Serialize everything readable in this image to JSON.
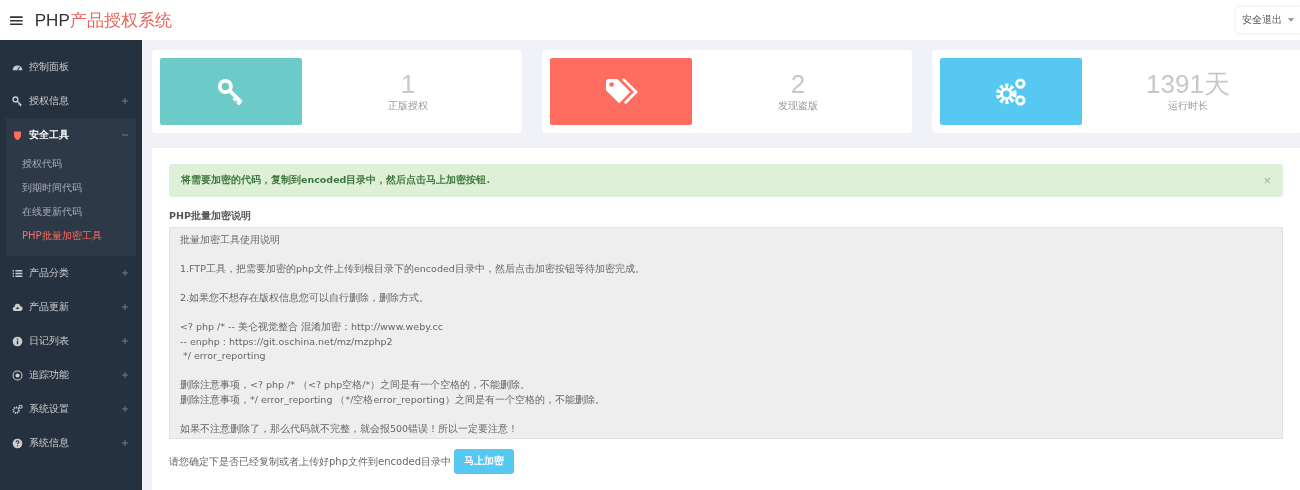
{
  "header": {
    "menu_glyph": "≡",
    "title_prefix": "PHP",
    "title_rest": "产品授权系统",
    "user_menu": "安全退出"
  },
  "sidebar": {
    "items": [
      {
        "label": "控制面板",
        "kind": "dashboard"
      },
      {
        "label": "授权信息",
        "kind": "key",
        "expanded": false
      },
      {
        "label": "安全工具",
        "kind": "shield",
        "expanded": true,
        "children": [
          {
            "label": "授权代码",
            "selected": false
          },
          {
            "label": "到期时间代码",
            "selected": false
          },
          {
            "label": "在线更新代码",
            "selected": false
          },
          {
            "label": "PHP批量加密工具",
            "selected": true
          }
        ]
      },
      {
        "label": "产品分类",
        "kind": "list",
        "expanded": false
      },
      {
        "label": "产品更新",
        "kind": "cloud",
        "expanded": false
      },
      {
        "label": "日记列表",
        "kind": "info",
        "expanded": false
      },
      {
        "label": "追踪功能",
        "kind": "target",
        "expanded": false
      },
      {
        "label": "系统设置",
        "kind": "gears",
        "expanded": false
      },
      {
        "label": "系统信息",
        "kind": "question",
        "expanded": false
      }
    ]
  },
  "stats": [
    {
      "kind": "key",
      "color": "#6ccac9",
      "value": "1",
      "label": "正版授权"
    },
    {
      "kind": "tags",
      "color": "#ff6c60",
      "value": "2",
      "label": "发现盗版"
    },
    {
      "kind": "gears",
      "color": "#57c8f2",
      "value": "1391天",
      "label": "运行时长"
    }
  ],
  "alert": {
    "text": "将需要加密的代码，复制到encoded目录中，然后点击马上加密按钮.",
    "close": "×"
  },
  "editor": {
    "label": "PHP批量加密说明",
    "paragraphs": [
      [
        "批量加密工具使用说明"
      ],
      [
        "1.FTP工具，把需要加密的php文件上传到根目录下的encoded目录中，然后点击加密按钮等待加密完成。"
      ],
      [
        "2.如果您不想存在版权信息您可以自行删除，删除方式。"
      ],
      [
        "<? php /* -- 美仑视觉整合 混淆加密：http://www.weby.cc",
        "-- enphp : https://git.oschina.net/mz/mzphp2",
        " */ error_reporting"
      ],
      [
        "删除注意事项，<? php /* （<? php空格/*）之间是有一个空格的，不能删除。",
        "删除注意事项，*/ error_reporting （*/空格error_reporting）之间是有一个空格的，不能删除。"
      ],
      [
        "如果不注意删除了，那么代码就不完整，就会报500错误！所以一定要注意！"
      ]
    ]
  },
  "footer": {
    "hint": "请您确定下是否已经复制或者上传好php文件到encoded目录中",
    "button": "马上加密"
  }
}
